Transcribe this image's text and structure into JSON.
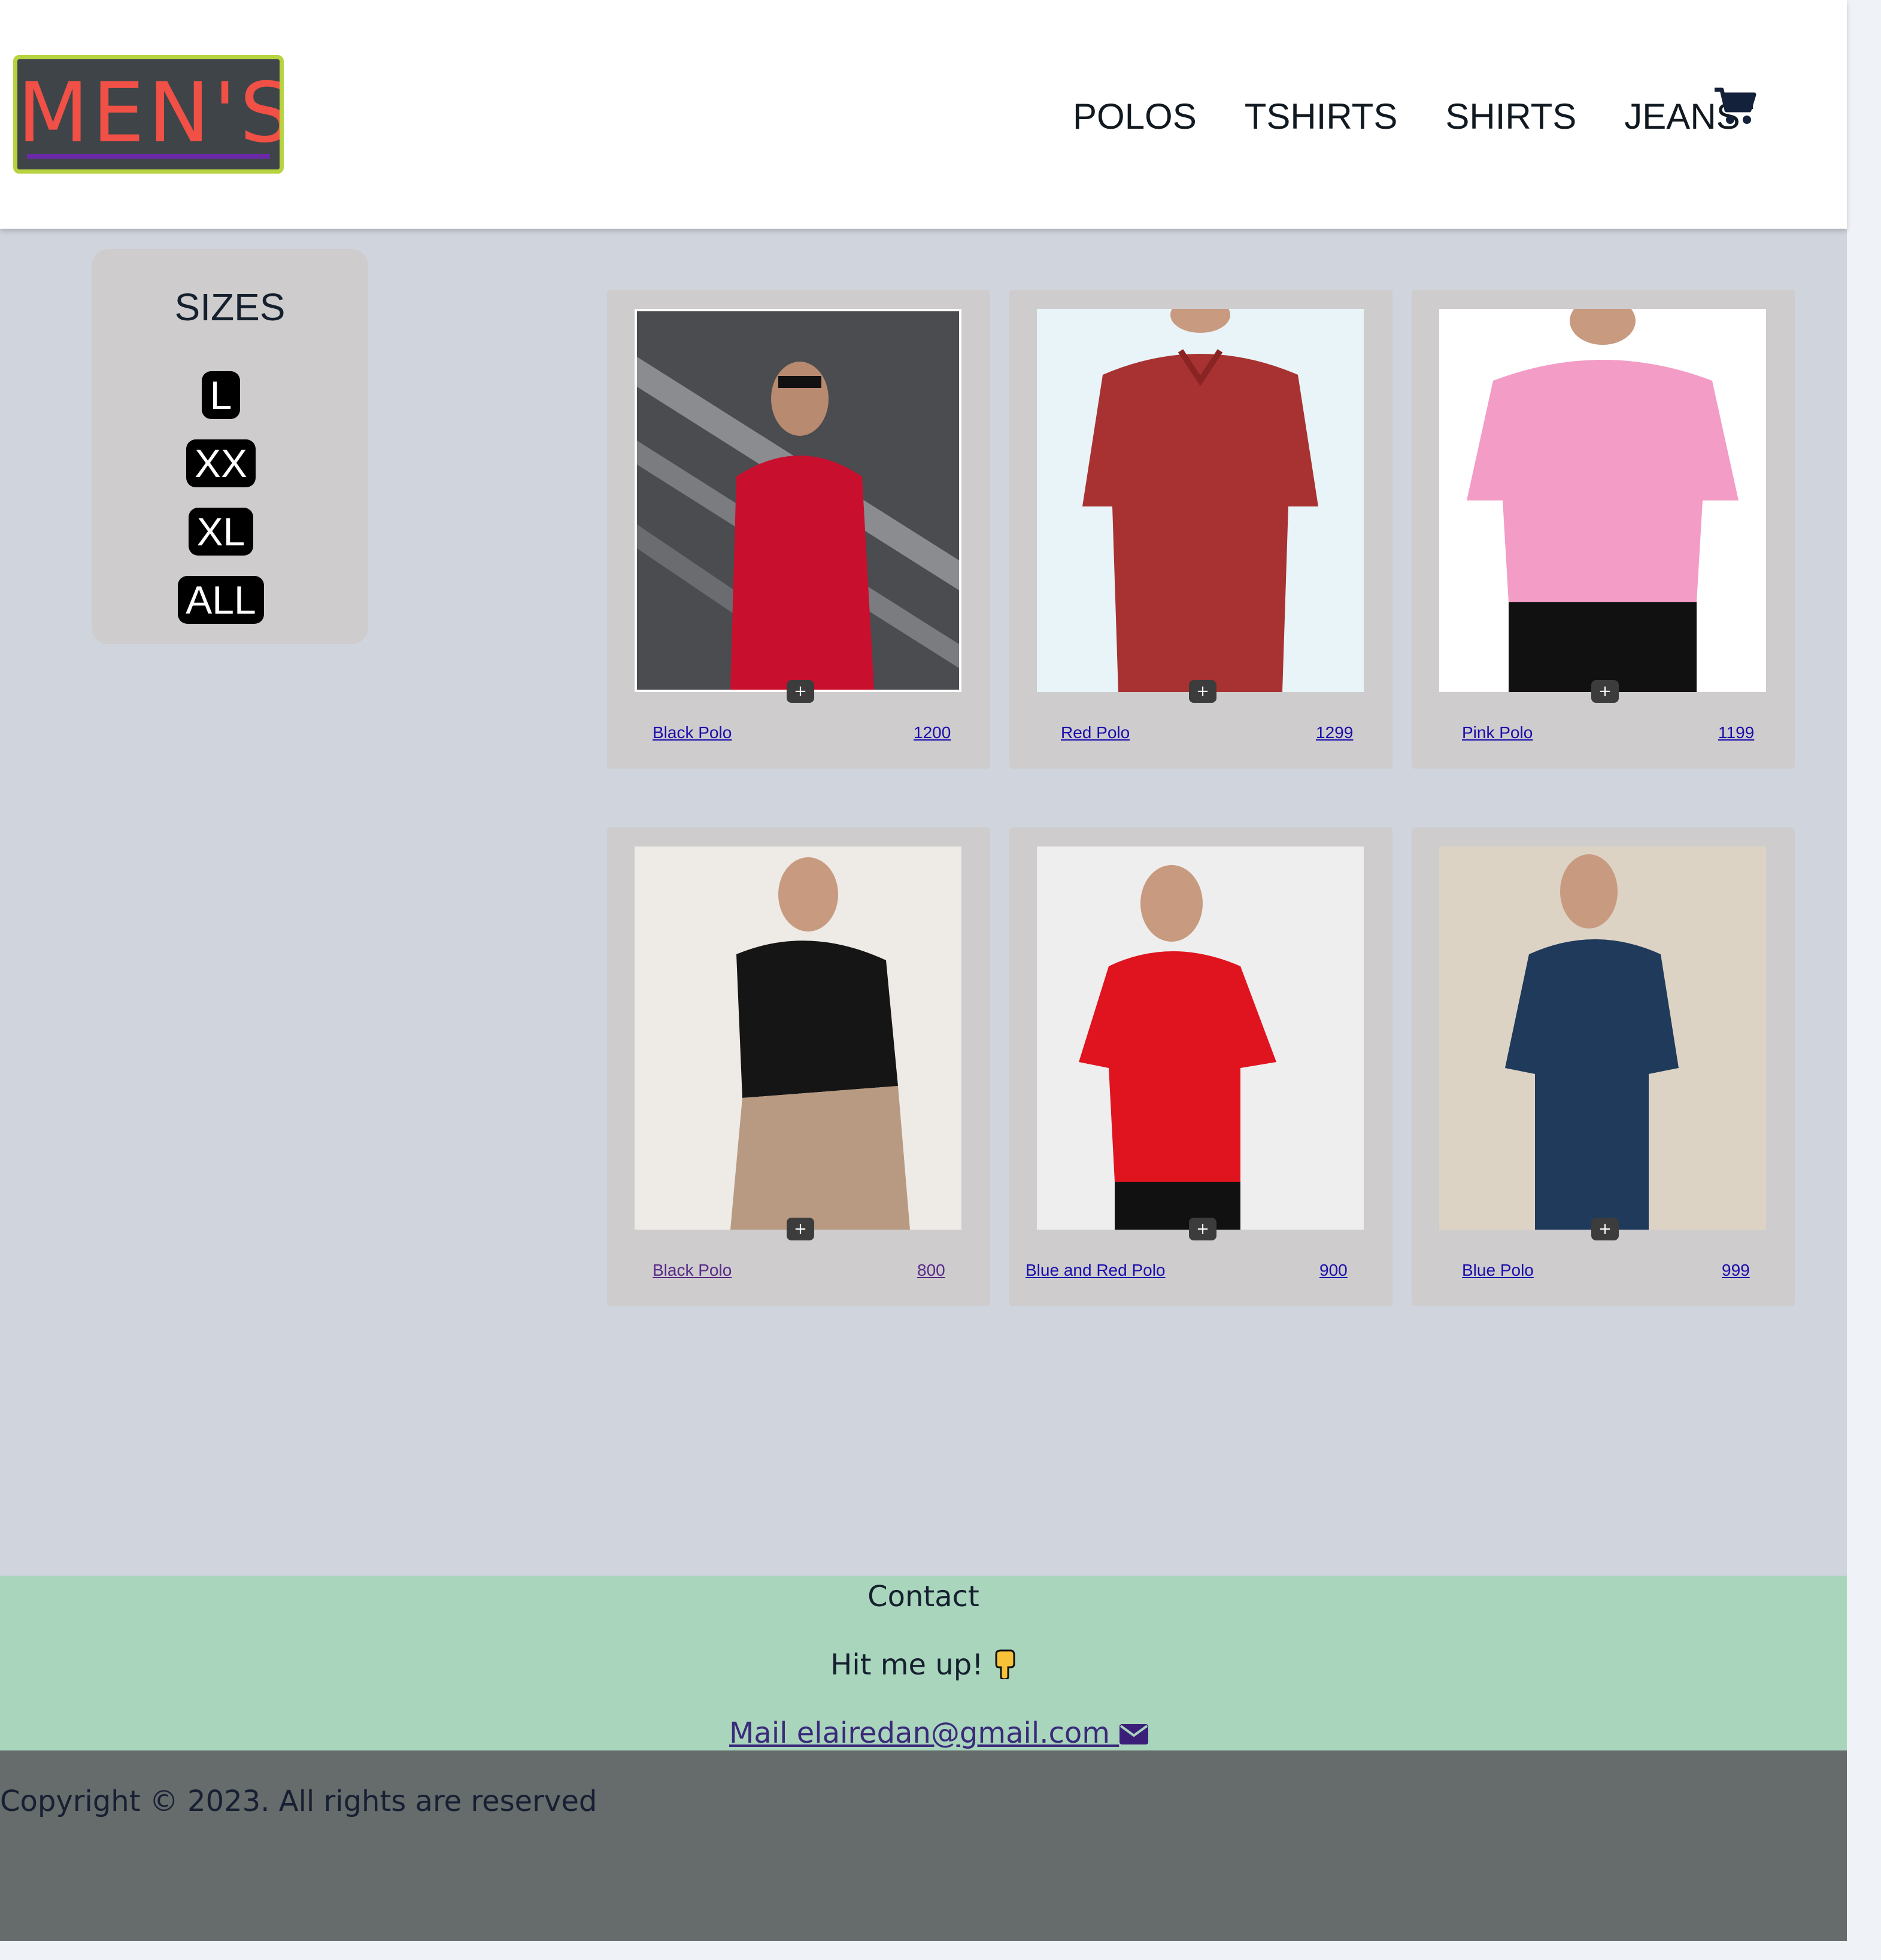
{
  "header": {
    "logo_text": "MEN'S",
    "nav": [
      "POLOS",
      "TSHIRTS",
      "SHIRTS",
      "JEANS"
    ],
    "cart_icon": "shopping-cart-icon"
  },
  "sizes": {
    "title": "SIZES",
    "options": [
      "L",
      "XX",
      "XL",
      "ALL"
    ]
  },
  "products": [
    {
      "name": "Black Polo",
      "price": "1200",
      "add_label": "+"
    },
    {
      "name": "Red Polo",
      "price": "1299",
      "add_label": "+"
    },
    {
      "name": "Pink Polo",
      "price": "1199",
      "add_label": "+"
    },
    {
      "name": "Black Polo",
      "price": "800",
      "add_label": "+"
    },
    {
      "name": "Blue and Red Polo",
      "price": "900",
      "add_label": "+"
    },
    {
      "name": "Blue Polo",
      "price": "999",
      "add_label": "+"
    }
  ],
  "footer": {
    "contact_title": "Contact",
    "hit_me_up": "Hit me up!",
    "hit_icon": "pointing-down-hand-icon",
    "mail_text": "Mail elairedan@gmail.com ",
    "mail_icon": "envelope-icon",
    "copyright": "Copyright © 2023. All rights are reserved"
  },
  "colors": {
    "page_bg": "#d0d4dc",
    "header_bg": "#ffffff",
    "card_bg": "#cecccd",
    "contact_bg": "#aad5bd",
    "copyright_bg": "#666b6b",
    "logo_border": "#b7d33f",
    "logo_text": "#f05045",
    "link": "#1a0dab"
  }
}
